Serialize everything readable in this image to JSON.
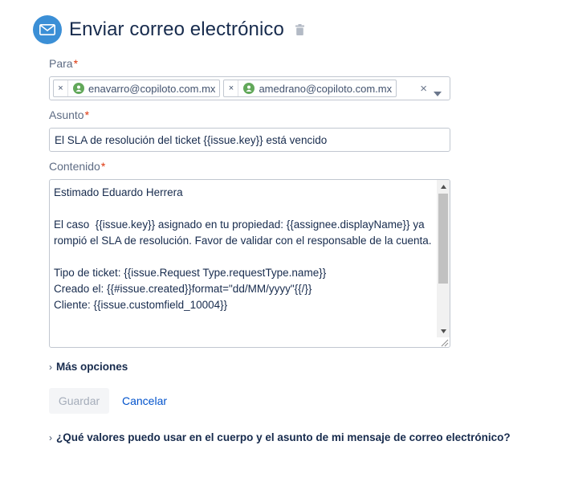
{
  "header": {
    "title": "Enviar correo electrónico",
    "icon": "mail-icon",
    "delete_icon": "trash-icon",
    "accent": "#3b8fd6"
  },
  "fields": {
    "para": {
      "label": "Para",
      "required_mark": "*",
      "recipients": [
        {
          "remove": "×",
          "email": "enavarro@copiloto.com.mx"
        },
        {
          "remove": "×",
          "email": "amedrano@copiloto.com.mx"
        }
      ],
      "clear": "×"
    },
    "asunto": {
      "label": "Asunto",
      "required_mark": "*",
      "value": "El SLA de resolución del ticket {{issue.key}} está vencido"
    },
    "contenido": {
      "label": "Contenido",
      "required_mark": "*",
      "value": "Estimado Eduardo Herrera\n\nEl caso  {{issue.key}} asignado en tu propiedad: {{assignee.displayName}} ya rompió el SLA de resolución. Favor de validar con el responsable de la cuenta.\n\nTipo de ticket: {{issue.Request Type.requestType.name}}\nCreado el: {{#issue.created}}format=\"dd/MM/yyyy\"{{/}}\nCliente: {{issue.customfield_10004}}"
    }
  },
  "more_options": {
    "chevron": "›",
    "label": "Más opciones"
  },
  "buttons": {
    "save": "Guardar",
    "cancel": "Cancelar"
  },
  "help": {
    "chevron": "›",
    "label": "¿Qué valores puedo usar en el cuerpo y el asunto de mi mensaje de correo electrónico?"
  },
  "colors": {
    "required": "#de350b",
    "link": "#0052cc",
    "disabled_text": "#a5adba",
    "chip_avatar": "#62a85a"
  }
}
